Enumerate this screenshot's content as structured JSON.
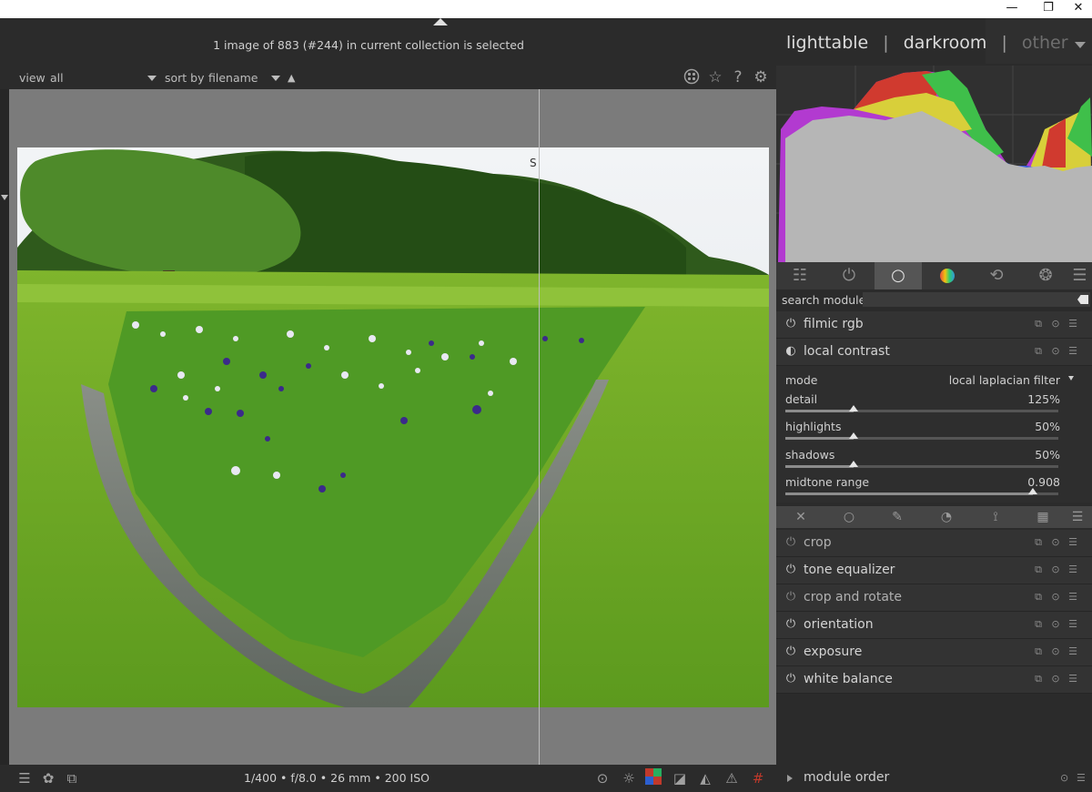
{
  "window": {
    "minimize_label": "—",
    "restore_label": "❐",
    "close_label": "✕"
  },
  "topbar": {
    "status": "1 image of 883 (#244) in current collection is selected",
    "views": {
      "lighttable": "lighttable",
      "darkroom": "darkroom",
      "other": "other",
      "separator": "|"
    }
  },
  "filterbar": {
    "view_label": "view",
    "view_value": "all",
    "sort_label": "sort by",
    "sort_value": "filename",
    "sort_direction": "▲",
    "icons": [
      "grouping-icon",
      "star-icon",
      "help-icon",
      "settings-icon"
    ]
  },
  "center": {
    "split_label": "S"
  },
  "bottombar": {
    "exif": "1/400 • f/8.0 • 26 mm • 200 ISO"
  },
  "right": {
    "search_label": "search module",
    "search_value": "",
    "module_groups": [
      "quick-access-icon",
      "active-modules-icon",
      "base-group-icon",
      "color-group-icon",
      "correct-group-icon",
      "effect-group-icon",
      "menu-icon"
    ],
    "active_group_index": 2,
    "modules_top": [
      {
        "name": "filmic rgb",
        "enabled": true
      },
      {
        "name": "local contrast",
        "enabled": true,
        "expanded": true
      }
    ],
    "local_contrast": {
      "mode_label": "mode",
      "mode_value": "local laplacian filter",
      "params": [
        {
          "label": "detail",
          "value": "125%",
          "fraction": 0.25
        },
        {
          "label": "highlights",
          "value": "50%",
          "fraction": 0.25
        },
        {
          "label": "shadows",
          "value": "50%",
          "fraction": 0.25
        },
        {
          "label": "midtone range",
          "value": "0.908",
          "fraction": 0.908
        }
      ]
    },
    "modules_bottom": [
      {
        "name": "crop",
        "enabled": false
      },
      {
        "name": "tone equalizer",
        "enabled": true
      },
      {
        "name": "crop and rotate",
        "enabled": false
      },
      {
        "name": "orientation",
        "enabled": true
      },
      {
        "name": "exposure",
        "enabled": true
      },
      {
        "name": "white balance",
        "enabled": true
      }
    ],
    "module_order_label": "module order"
  },
  "colors": {
    "background": "#2b2b2b",
    "panel": "#333333",
    "center_bg": "#7b7b7b",
    "histogram_red": "#d03a2f",
    "histogram_green": "#3fbf4a",
    "histogram_blue": "#3a5bd9",
    "histogram_yellow": "#d8cf3a",
    "histogram_magenta": "#b23ad0",
    "histogram_cyan": "#3ab0c8"
  }
}
